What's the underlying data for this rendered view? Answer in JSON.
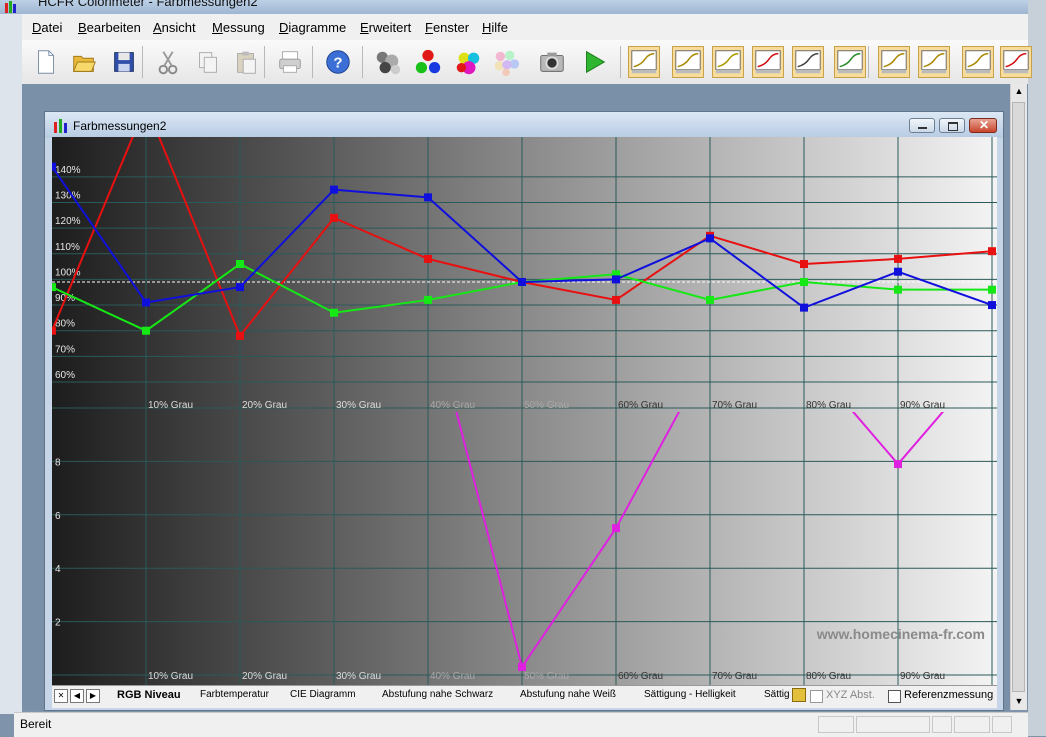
{
  "app": {
    "title": "HCFR Colorimeter - Farbmessungen2",
    "status": "Bereit"
  },
  "menu": [
    "Datei",
    "Bearbeiten",
    "Ansicht",
    "Messung",
    "Diagramme",
    "Erweitert",
    "Fenster",
    "Hilfe"
  ],
  "menu_underline": [
    "D",
    "B",
    "A",
    "M",
    "D",
    "E",
    "F",
    "H"
  ],
  "toolbar": {
    "icons": [
      "new-document-icon",
      "open-folder-icon",
      "save-disk-icon",
      "cut-icon",
      "copy-icon",
      "paste-icon",
      "print-icon",
      "help-icon",
      "gray-spheres-icon",
      "rgb-spheres-icon",
      "color-spheres-icon",
      "multi-spheres-icon",
      "camera-icon",
      "play-icon",
      "chart-gamma-icon",
      "chart-luminance-icon",
      "chart-curve-icon",
      "chart-rgb-icon",
      "chart-delta-icon",
      "chart-cie-icon",
      "chart-yellow-icon",
      "chart-line-icon",
      "chart-bars-icon",
      "chart-extra-icon"
    ]
  },
  "child": {
    "title": "Farbmessungen2",
    "watermark": "www.homecinema-fr.com"
  },
  "tabs": {
    "items": [
      "RGB Niveau",
      "Farbtemperatur",
      "CIE Diagramm",
      "Abstufung nahe Schwarz",
      "Abstufung nahe Weiß",
      "Sättigung - Helligkeit",
      "Sättig"
    ],
    "active": 0,
    "xyz_label": "XYZ Abst.",
    "ref_label": "Referenzmessung"
  },
  "chart_data": [
    {
      "type": "line",
      "categories": [
        "",
        "10% Grau",
        "20% Grau",
        "30% Grau",
        "40% Grau",
        "50% Grau",
        "60% Grau",
        "70% Grau",
        "80% Grau",
        "90% Grau",
        ""
      ],
      "ylim": [
        60,
        145
      ],
      "yticks": [
        "60%",
        "70%",
        "80%",
        "90%",
        "100%",
        "110%",
        "120%",
        "130%",
        "140%"
      ],
      "reference": 99,
      "series": [
        {
          "color": "#e81010",
          "values": [
            80,
            168,
            78,
            124,
            108,
            99,
            92,
            117,
            106,
            108,
            111
          ]
        },
        {
          "color": "#16e816",
          "values": [
            97,
            80,
            106,
            87,
            92,
            99,
            102,
            92,
            99,
            96,
            96
          ]
        },
        {
          "color": "#1010dd",
          "values": [
            144,
            91,
            97,
            135,
            132,
            99,
            100,
            116,
            89,
            103,
            90
          ]
        }
      ]
    },
    {
      "type": "line",
      "categories": [
        "",
        "10% Grau",
        "20% Grau",
        "30% Grau",
        "40% Grau",
        "50% Grau",
        "60% Grau",
        "70% Grau",
        "80% Grau",
        "90% Grau",
        ""
      ],
      "ylim": [
        0,
        10
      ],
      "yticks": [
        "2",
        "4",
        "6",
        "8"
      ],
      "series": [
        {
          "color": "#e020e0",
          "values": [
            null,
            null,
            null,
            null,
            null,
            0.3,
            5.5,
            null,
            null,
            7.9,
            null
          ]
        }
      ]
    }
  ]
}
